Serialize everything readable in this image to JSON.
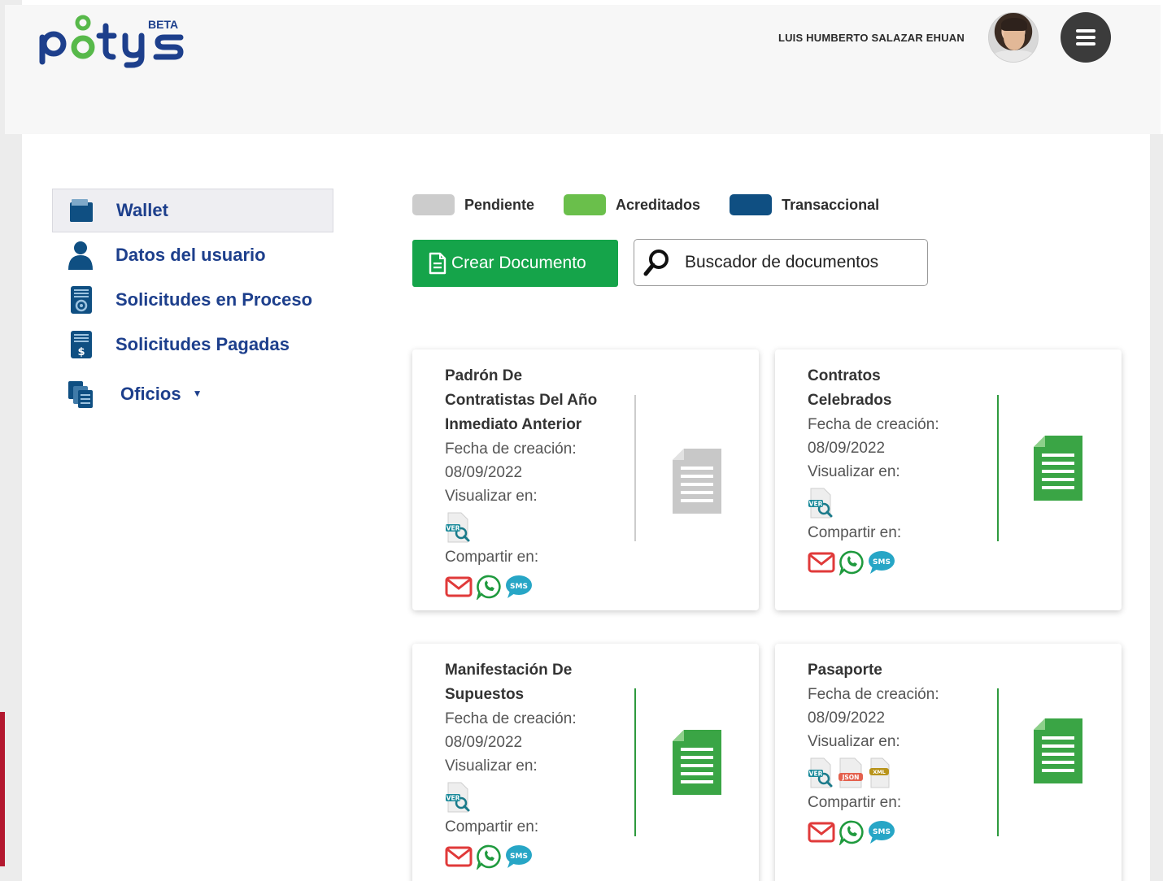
{
  "header": {
    "logo_text": "pōtys",
    "logo_badge": "BETA",
    "user_name": "LUIS HUMBERTO SALAZAR EHUAN"
  },
  "sidebar": {
    "items": [
      {
        "label": "Wallet",
        "icon": "folder-icon",
        "active": true
      },
      {
        "label": "Datos del usuario",
        "icon": "user-icon",
        "active": false
      },
      {
        "label": "Solicitudes en Proceso",
        "icon": "process-document-icon",
        "active": false
      },
      {
        "label": "Solicitudes Pagadas",
        "icon": "paid-document-icon",
        "active": false
      },
      {
        "label": "Oficios",
        "icon": "stacked-documents-icon",
        "active": false,
        "dropdown": true
      }
    ]
  },
  "legend": [
    {
      "label": "Pendiente",
      "color": "#cccccc"
    },
    {
      "label": "Acreditados",
      "color": "#6abf4b"
    },
    {
      "label": "Transaccional",
      "color": "#0f4f82"
    }
  ],
  "actions": {
    "create_label": "Crear Documento",
    "search_placeholder": "Buscador de documentos"
  },
  "labels": {
    "created": "Fecha de creación:",
    "view": "Visualizar en:",
    "share": "Compartir en:"
  },
  "cards": [
    {
      "title_lines": [
        "Padrón De",
        "Contratistas Del Año",
        "Inmediato Anterior"
      ],
      "date": "08/09/2022",
      "status": "pendiente",
      "status_color": "#cccccc",
      "view_formats": [
        "VER"
      ]
    },
    {
      "title_lines": [
        "Contratos",
        "Celebrados"
      ],
      "date": "08/09/2022",
      "status": "acreditado",
      "status_color": "#2e9a3e",
      "view_formats": [
        "VER"
      ]
    },
    {
      "title_lines": [
        "Manifestación De",
        "Supuestos"
      ],
      "date": "08/09/2022",
      "status": "acreditado",
      "status_color": "#2e9a3e",
      "view_formats": [
        "VER"
      ]
    },
    {
      "title_lines": [
        "Pasaporte"
      ],
      "date": "08/09/2022",
      "status": "acreditado",
      "status_color": "#2e9a3e",
      "view_formats": [
        "VER",
        "JSON",
        "XML"
      ]
    }
  ],
  "share_channels": [
    "email-icon",
    "whatsapp-icon",
    "sms-icon"
  ],
  "sms_label": "SMS",
  "colors": {
    "brand_blue": "#1d3f8c",
    "brand_green": "#15a44a",
    "email_red": "#e03a3a",
    "whatsapp_green": "#1f9a3e",
    "sms_teal": "#27a6c6"
  }
}
